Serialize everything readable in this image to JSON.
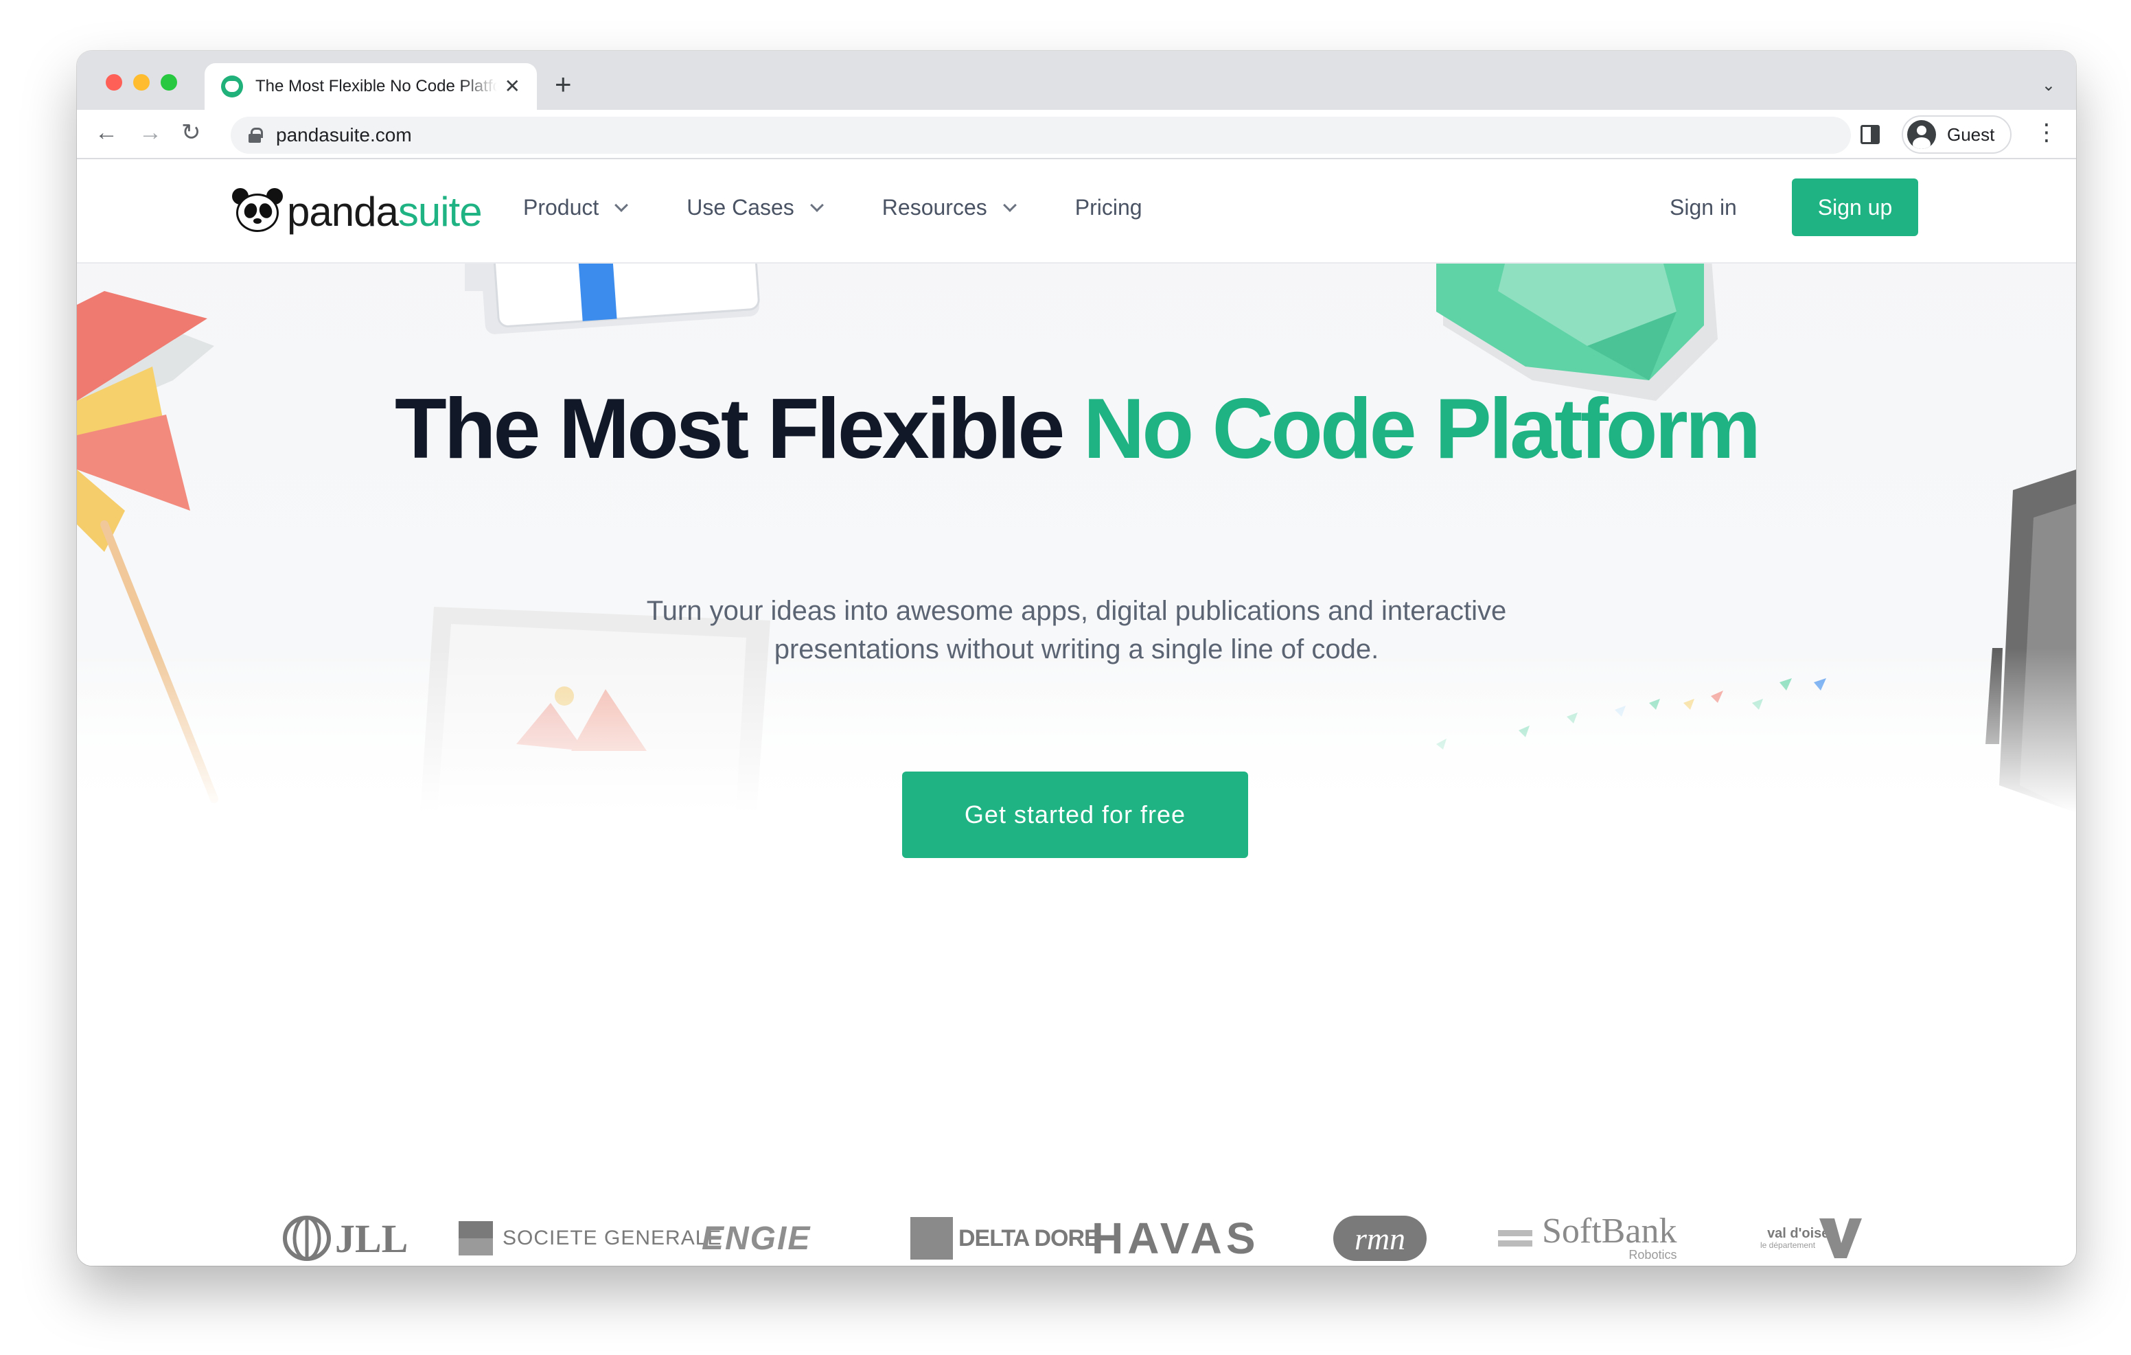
{
  "browser": {
    "tab_title": "The Most Flexible No Code Platform",
    "tab_close": "✕",
    "new_tab": "+",
    "tab_menu": "⌄",
    "back": "←",
    "forward": "→",
    "reload": "↻",
    "url": "pandasuite.com",
    "profile_label": "Guest",
    "menu": "⋮"
  },
  "site": {
    "logo": {
      "part1": "panda",
      "part2": "suite"
    },
    "nav": [
      {
        "label": "Product",
        "has_dropdown": true
      },
      {
        "label": "Use Cases",
        "has_dropdown": true
      },
      {
        "label": "Resources",
        "has_dropdown": true
      },
      {
        "label": "Pricing",
        "has_dropdown": false
      }
    ],
    "sign_in": "Sign in",
    "sign_up": "Sign up"
  },
  "hero": {
    "title_main": "The Most Flexible",
    "title_accent": "No Code Platform",
    "subtitle_line1": "Turn your ideas into awesome apps, digital publications and interactive",
    "subtitle_line2": "presentations without writing a single line of code.",
    "cta": "Get started for free"
  },
  "client_logos": [
    {
      "name": "JLL",
      "text": "JLL"
    },
    {
      "name": "Societe Generale",
      "text": "SOCIETE GENERALE"
    },
    {
      "name": "Engie",
      "text": "ENGIE"
    },
    {
      "name": "Delta Dore",
      "text": "DELTA DORE"
    },
    {
      "name": "Havas",
      "text": "HAVAS"
    },
    {
      "name": "RMN",
      "text": "rmn"
    },
    {
      "name": "SoftBank Robotics",
      "text": "SoftBank",
      "subtext": "Robotics"
    },
    {
      "name": "Val d'Oise",
      "text": "val d'oise",
      "subtext": "le département"
    }
  ],
  "colors": {
    "brand_green": "#1fb383",
    "heading_dark": "#111827",
    "text_gray": "#5b6473"
  }
}
